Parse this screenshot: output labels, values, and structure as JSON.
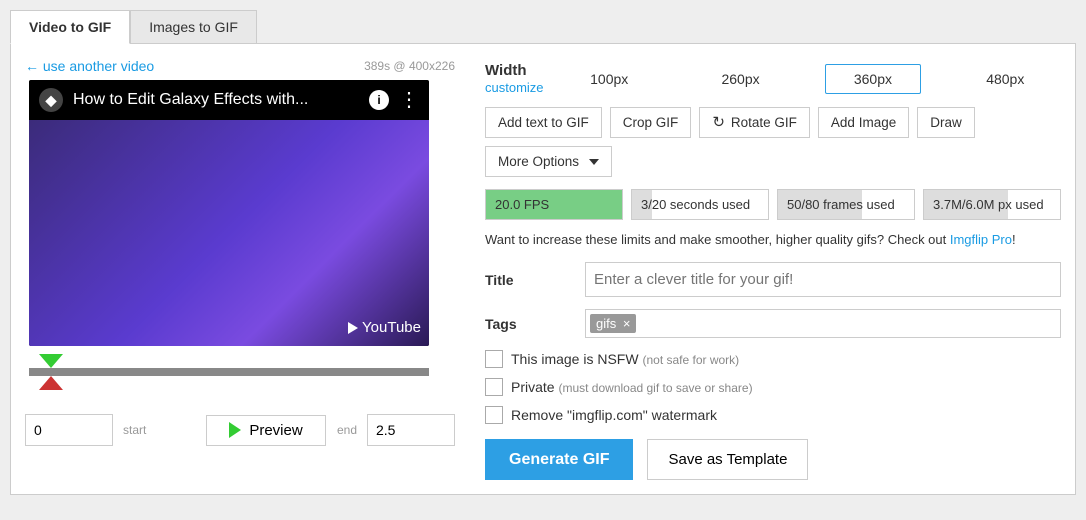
{
  "tabs": {
    "video": "Video to GIF",
    "images": "Images to GIF"
  },
  "use_another": "← use another video",
  "video_meta": "389s @ 400x226",
  "yt_title": "How to Edit Galaxy Effects with...",
  "yt_badge": "YouTube",
  "start_value": "0",
  "start_lbl": "start",
  "end_value": "2.5",
  "end_lbl": "end",
  "preview": "Preview",
  "width": {
    "label": "Width",
    "customize": "customize",
    "opts": [
      "100px",
      "260px",
      "360px",
      "480px"
    ]
  },
  "tools": {
    "addtext": "Add text to GIF",
    "crop": "Crop GIF",
    "rotate": "Rotate GIF",
    "addimg": "Add Image",
    "draw": "Draw",
    "more": "More Options"
  },
  "stats": {
    "fps": "20.0 FPS",
    "seconds": "3/20 seconds used",
    "frames": "50/80 frames used",
    "px": "3.7M/6.0M px used"
  },
  "promo": {
    "a": "Want to increase these limits and make smoother, higher quality gifs? Check out ",
    "b": "Imgflip Pro",
    "c": "!"
  },
  "title": {
    "label": "Title",
    "placeholder": "Enter a clever title for your gif!"
  },
  "tags": {
    "label": "Tags",
    "tag": "gifs",
    "x": "×"
  },
  "nsfw": {
    "a": "This image is NSFW",
    "b": "(not safe for work)"
  },
  "private": {
    "a": "Private",
    "b": "(must download gif to save or share)"
  },
  "watermark": "Remove \"imgflip.com\" watermark",
  "generate": "Generate GIF",
  "save_tpl": "Save as Template"
}
